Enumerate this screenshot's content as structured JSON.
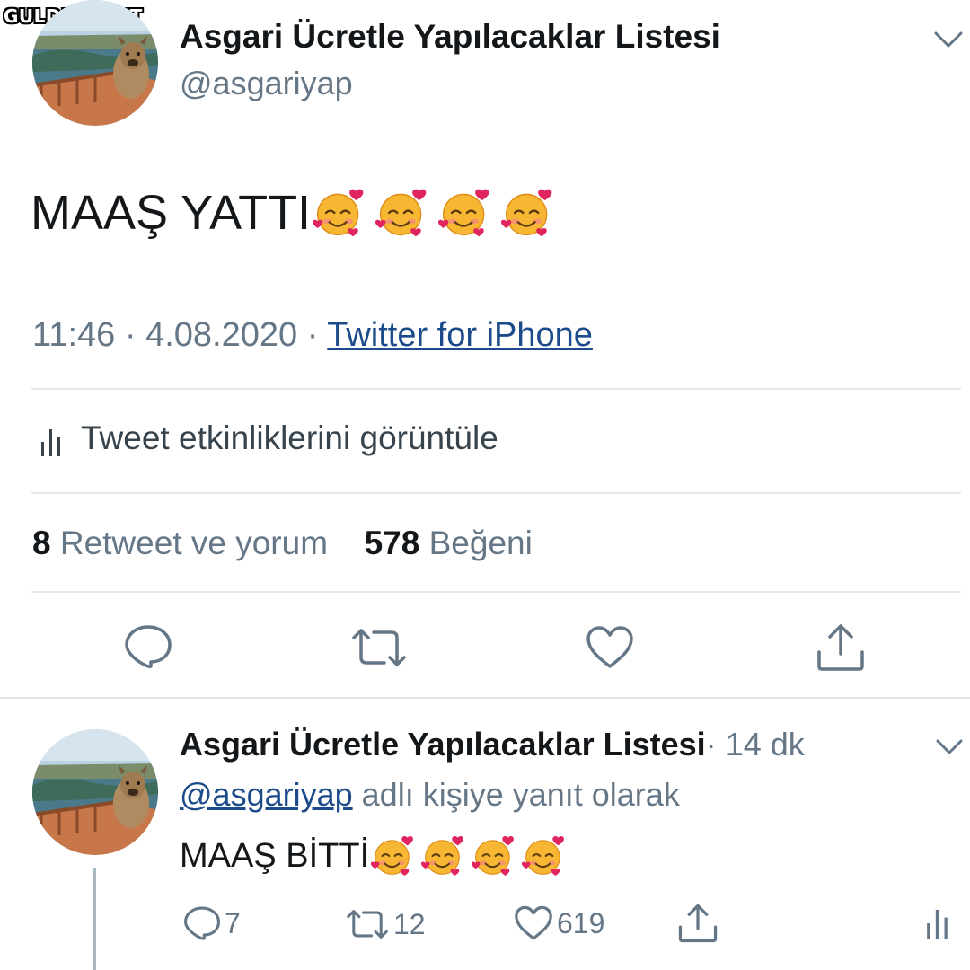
{
  "watermark": "GULDUM.NET",
  "main_tweet": {
    "author_name": "Asgari Ücretle Yapılacaklar Listesi",
    "handle": "@asgariyap",
    "text": "MAAŞ YATTI",
    "emoji": [
      "smiling-face-with-hearts",
      "smiling-face-with-hearts",
      "smiling-face-with-hearts",
      "smiling-face-with-hearts"
    ],
    "time": "11:46",
    "date": "4.08.2020",
    "separator": "·",
    "source": "Twitter for iPhone",
    "activity_label": "Tweet etkinliklerini görüntüle",
    "retweet_count": "8",
    "retweet_label": "Retweet ve yorum",
    "like_count": "578",
    "like_label": "Beğeni",
    "actions": [
      "reply-icon",
      "retweet-icon",
      "like-icon",
      "share-icon"
    ]
  },
  "reply_tweet": {
    "author_name": "Asgari Ücretle Yapılacaklar Listesi",
    "dot": "·",
    "time_ago": "14 dk",
    "mention": "@asgariyap",
    "reply_context": "adlı kişiye yanıt olarak",
    "text": "MAAŞ BİTTİ",
    "emoji": [
      "smiling-face-with-hearts",
      "smiling-face-with-hearts",
      "smiling-face-with-hearts",
      "smiling-face-with-hearts"
    ],
    "reply_count": "7",
    "retweet_count": "12",
    "like_count": "619"
  },
  "colors": {
    "text": "#14171a",
    "secondary": "#657786",
    "link": "#1b4b8a",
    "divider": "#e1e8ed"
  }
}
